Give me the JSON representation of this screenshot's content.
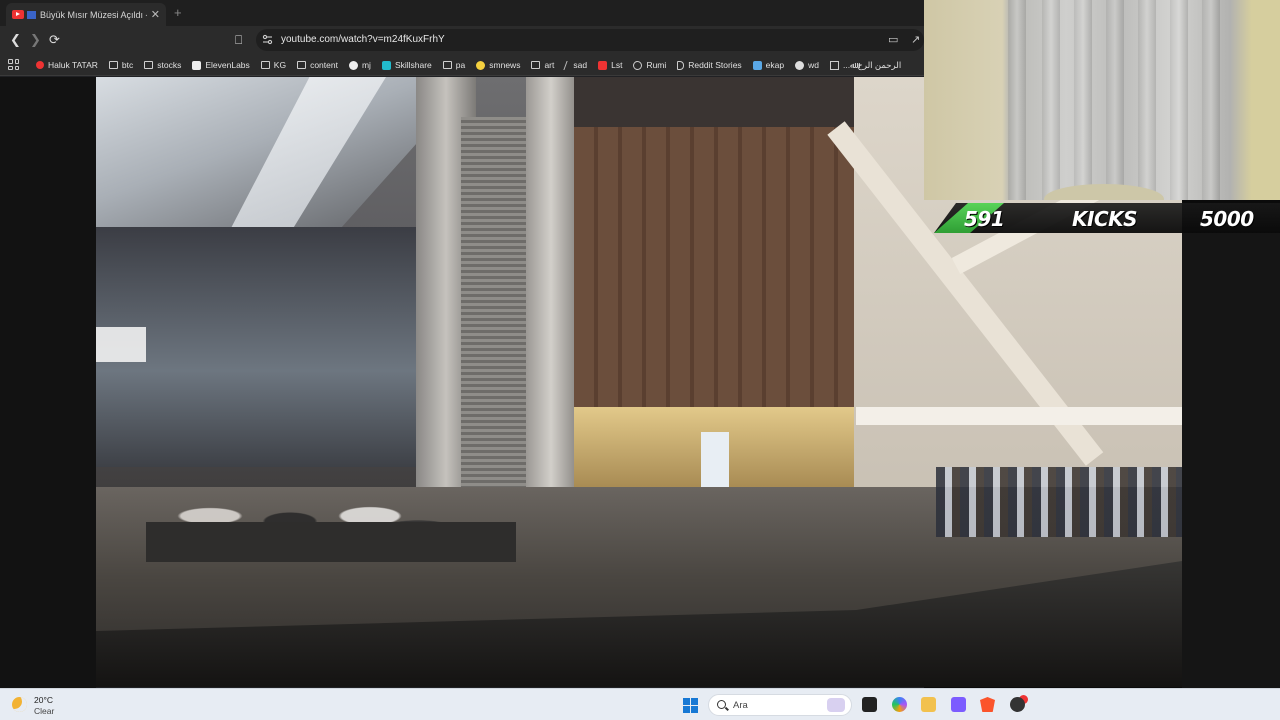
{
  "browser": {
    "tab": {
      "title": "Büyük Mısır Müzesi Açıldı - Y",
      "close_label": "✕"
    },
    "new_tab_label": "+",
    "url": "youtube.com/watch?v=m24fKuxFrhY",
    "bookmarks": [
      {
        "label": "Haluk TATAR",
        "icon": "youtube-icon"
      },
      {
        "label": "btc",
        "icon": "folder-icon"
      },
      {
        "label": "stocks",
        "icon": "folder-icon"
      },
      {
        "label": "ElevenLabs",
        "icon": "elevenlabs-icon"
      },
      {
        "label": "KG",
        "icon": "folder-icon"
      },
      {
        "label": "content",
        "icon": "folder-icon"
      },
      {
        "label": "mj",
        "icon": "github-icon"
      },
      {
        "label": "Skillshare",
        "icon": "skillshare-icon"
      },
      {
        "label": "pa",
        "icon": "folder-icon"
      },
      {
        "label": "smnews",
        "icon": "smiley-icon"
      },
      {
        "label": "art",
        "icon": "folder-icon"
      },
      {
        "label": "sad",
        "icon": "slash-icon"
      },
      {
        "label": "Lst",
        "icon": "s-logo-icon"
      },
      {
        "label": "Rumi",
        "icon": "globe-icon"
      },
      {
        "label": "Reddit Stories",
        "icon": "d-logo-icon"
      },
      {
        "label": "ekap",
        "icon": "bird-icon"
      },
      {
        "label": "wd",
        "icon": "wd-icon"
      },
      {
        "label": "...الرحمن الرح ﷲ",
        "icon": "document-icon"
      }
    ]
  },
  "overlay": {
    "count": "591",
    "label": "KICKS",
    "goal": "5000"
  },
  "taskbar": {
    "temperature": "20°C",
    "condition": "Clear",
    "search_placeholder": "Ara"
  },
  "colors": {
    "accent_green": "#3fbf44",
    "youtube_red": "#e33333",
    "taskbar_bg": "#e7ecf3"
  }
}
